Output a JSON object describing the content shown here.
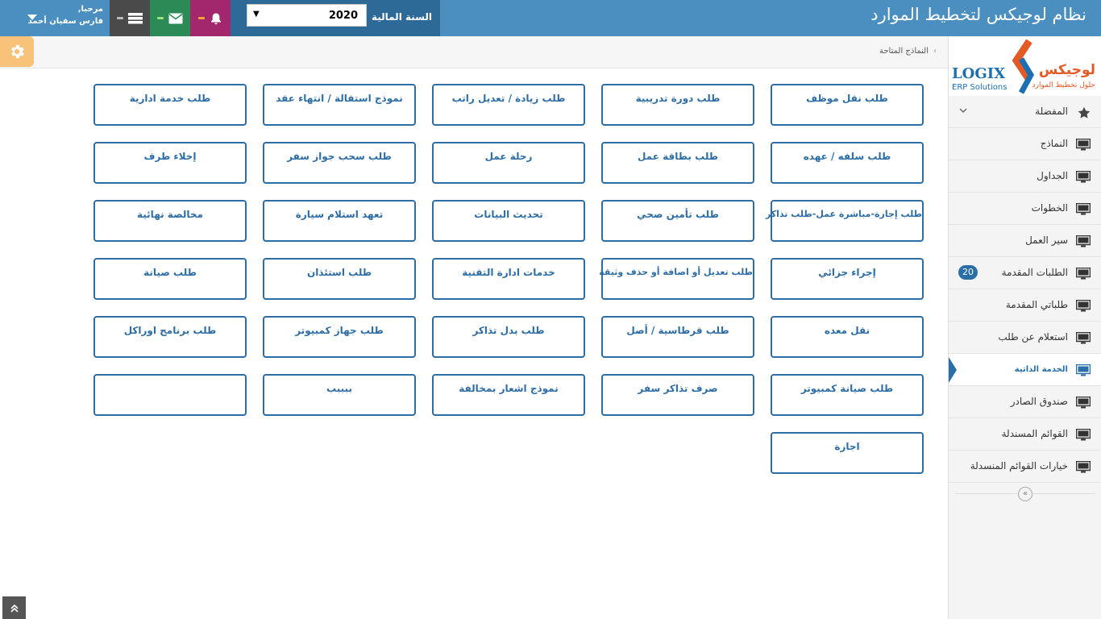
{
  "header": {
    "title": "نظام لوجيكس لتخطيط الموارد",
    "fiscal_year_label": "السنة المالية",
    "fiscal_year_value": "2020",
    "user_greeting": "مرحبا,",
    "user_name": "فارس سفيان أحمد"
  },
  "breadcrumb": {
    "current": "النماذج المتاحة"
  },
  "logo": {
    "english": "LOGIX",
    "english_sub": "ERP Solutions",
    "arabic": "لوجيكس",
    "arabic_sub": "حلول تخطيط الموارد"
  },
  "sidebar": {
    "items": [
      {
        "label": "المفضلة",
        "icon": "star-icon"
      },
      {
        "label": "النماذج",
        "icon": "monitor-icon"
      },
      {
        "label": "الجداول",
        "icon": "monitor-icon"
      },
      {
        "label": "الخطوات",
        "icon": "monitor-icon"
      },
      {
        "label": "سير العمل",
        "icon": "monitor-icon"
      },
      {
        "label": "الطلبات المقدمة",
        "icon": "monitor-icon",
        "badge": "20"
      },
      {
        "label": "طلباتي المقدمة",
        "icon": "monitor-icon"
      },
      {
        "label": "استعلام عن طلب",
        "icon": "monitor-icon"
      },
      {
        "label": "الخدمة الذاتية",
        "icon": "monitor-icon",
        "active": true
      },
      {
        "label": "صندوق الصادر",
        "icon": "monitor-icon"
      },
      {
        "label": "القوائم المسندلة",
        "icon": "monitor-icon"
      },
      {
        "label": "خيارات القوائم المنسدلة",
        "icon": "monitor-icon"
      }
    ]
  },
  "forms": {
    "row1": [
      "طلب نقل موظف",
      "طلب دورة تدريبية",
      "طلب زيادة / تعديل راتب",
      "نموذج استقالة / انتهاء عقد",
      "طلب خدمة ادارية"
    ],
    "row2": [
      "طلب سلفه / عهده",
      "طلب بطاقة عمل",
      "رحلة عمل",
      "طلب سحب جواز سفر",
      "إخلاء طرف"
    ],
    "row3": [
      "طلب إجازة-مباشرة عمل-طلب تذاكر",
      "طلب تأمين صحي",
      "تحديث البيانات",
      "تعهد استلام سيارة",
      "مخالصة نهائية"
    ],
    "row4": [
      "إجراء جزائي",
      "طلب تعديل أو اضافة أو حذف وثيقة",
      "خدمات ادارة التقنية",
      "طلب استئذان",
      "طلب صيانة"
    ],
    "row5": [
      "نقل معده",
      "طلب قرطاسية / أصل",
      "طلب بدل تذاكر",
      "طلب جهاز كمبيوتر",
      "طلب برنامج اوراكل"
    ],
    "row6": [
      "طلب صيانة كمبيوتر",
      "صرف تذاكر سفر",
      "نموذج اشعار بمخالفة",
      "ببببب",
      ""
    ],
    "row7": [
      "اجازة"
    ]
  },
  "colors": {
    "topbar": "#4a8fc0",
    "fiscal_box": "#2d6a98",
    "bell": "#a3276d",
    "mail": "#2b8a55",
    "list": "#4a4a4a",
    "accent": "#2e6da4",
    "gear": "#f9c27a"
  }
}
